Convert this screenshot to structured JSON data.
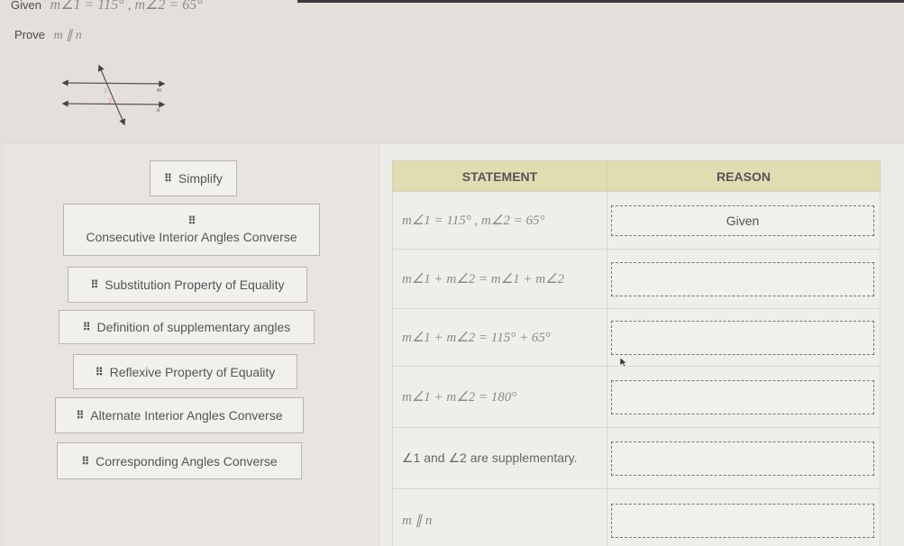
{
  "problem": {
    "given_label": "Given",
    "given_math": "m∠1 = 115° , m∠2 = 65°",
    "prove_label": "Prove",
    "prove_math": "m ∥ n"
  },
  "diagram": {
    "angle_labels": [
      "1",
      "2"
    ],
    "line_labels": [
      "m",
      "n"
    ],
    "angle_label_color": "#e07a8a"
  },
  "tiles": [
    {
      "label": "Simplify"
    },
    {
      "label": "Consecutive Interior Angles Converse"
    },
    {
      "label": "Substitution Property of Equality"
    },
    {
      "label": "Definition of supplementary angles"
    },
    {
      "label": "Reflexive Property of Equality"
    },
    {
      "label": "Alternate Interior Angles Converse"
    },
    {
      "label": "Corresponding Angles Converse"
    }
  ],
  "proof": {
    "headers": {
      "statement": "STATEMENT",
      "reason": "REASON"
    },
    "rows": [
      {
        "statement": "m∠1 = 115° , m∠2 = 65°",
        "reason": "Given"
      },
      {
        "statement": "m∠1 + m∠2 = m∠1 + m∠2",
        "reason": ""
      },
      {
        "statement": "m∠1 + m∠2 = 115° + 65°",
        "reason": ""
      },
      {
        "statement": "m∠1 + m∠2 = 180°",
        "reason": ""
      },
      {
        "statement": "∠1 and ∠2 are supplementary.",
        "reason": ""
      },
      {
        "statement": "m ∥ n",
        "reason": ""
      }
    ]
  },
  "colors": {
    "header_bg": "#e2dcb3",
    "page_bg": "#e3e0dc"
  }
}
